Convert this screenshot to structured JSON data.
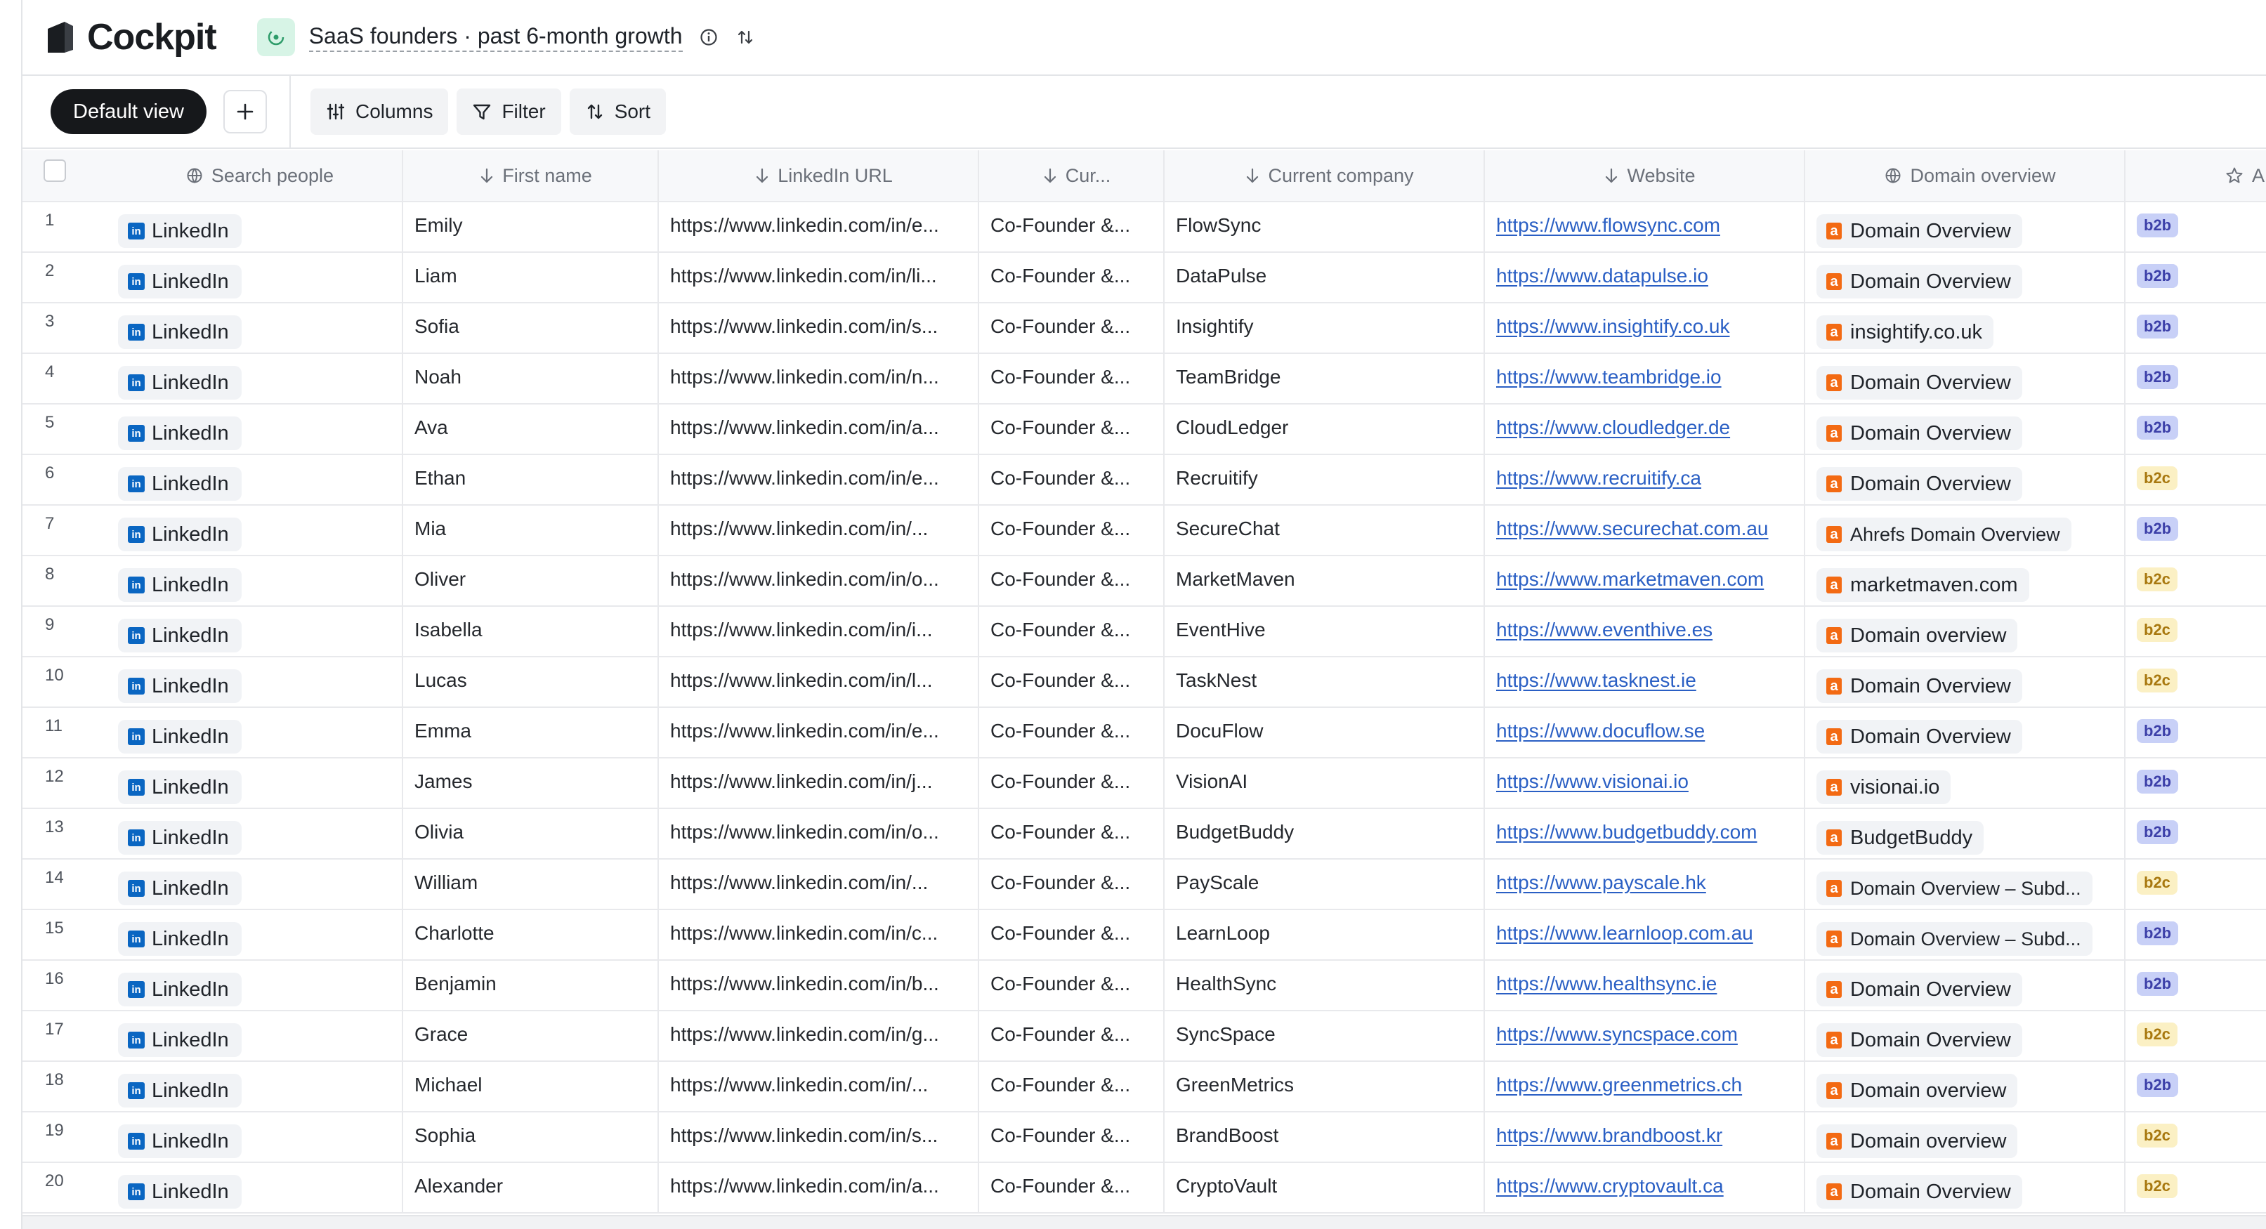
{
  "app": {
    "name": "Cockpit",
    "table_title": "SaaS founders · past 6-month growth"
  },
  "toolbar": {
    "view_label": "Default view",
    "columns_label": "Columns",
    "filter_label": "Filter",
    "sort_label": "Sort"
  },
  "columns": {
    "search": "Search people",
    "first_name": "First name",
    "linkedin_url": "LinkedIn URL",
    "current_title": "Cur...",
    "current_company": "Current company",
    "website": "Website",
    "domain_overview": "Domain overview",
    "next": "A"
  },
  "colors": {
    "b2b": "#c8d0f7",
    "b2c": "#fbf0c4",
    "link": "#2a5fc4",
    "linkedin": "#0a66c2",
    "ahrefs": "#f36a13"
  },
  "rows": [
    {
      "num": "1",
      "chip": "LinkedIn",
      "first": "Emily",
      "url": "https://www.linkedin.com/in/e...",
      "title": "Co-Founder &...",
      "company": "FlowSync",
      "website": "https://www.flowsync.com",
      "domain": "Domain Overview",
      "seg": "b2b"
    },
    {
      "num": "2",
      "chip": "LinkedIn",
      "first": "Liam",
      "url": "https://www.linkedin.com/in/li...",
      "title": "Co-Founder &...",
      "company": "DataPulse",
      "website": "https://www.datapulse.io",
      "domain": "Domain Overview",
      "seg": "b2b"
    },
    {
      "num": "3",
      "chip": "LinkedIn",
      "first": "Sofia",
      "url": "https://www.linkedin.com/in/s...",
      "title": "Co-Founder &...",
      "company": "Insightify",
      "website": "https://www.insightify.co.uk",
      "domain": "insightify.co.uk",
      "seg": "b2b"
    },
    {
      "num": "4",
      "chip": "LinkedIn",
      "first": "Noah",
      "url": "https://www.linkedin.com/in/n...",
      "title": "Co-Founder &...",
      "company": "TeamBridge",
      "website": "https://www.teambridge.io",
      "domain": "Domain Overview",
      "seg": "b2b"
    },
    {
      "num": "5",
      "chip": "LinkedIn",
      "first": "Ava",
      "url": "https://www.linkedin.com/in/a...",
      "title": "Co-Founder &...",
      "company": "CloudLedger",
      "website": "https://www.cloudledger.de",
      "domain": "Domain Overview",
      "seg": "b2b"
    },
    {
      "num": "6",
      "chip": "LinkedIn",
      "first": "Ethan",
      "url": "https://www.linkedin.com/in/e...",
      "title": "Co-Founder &...",
      "company": "Recruitify",
      "website": "https://www.recruitify.ca",
      "domain": "Domain Overview",
      "seg": "b2c"
    },
    {
      "num": "7",
      "chip": "LinkedIn",
      "first": "Mia",
      "url": "https://www.linkedin.com/in/...",
      "title": "Co-Founder &...",
      "company": "SecureChat",
      "website": "https://www.securechat.com.au",
      "domain": "Ahrefs Domain Overview",
      "seg": "b2b"
    },
    {
      "num": "8",
      "chip": "LinkedIn",
      "first": "Oliver",
      "url": "https://www.linkedin.com/in/o...",
      "title": "Co-Founder &...",
      "company": "MarketMaven",
      "website": "https://www.marketmaven.com",
      "domain": "marketmaven.com",
      "seg": "b2c"
    },
    {
      "num": "9",
      "chip": "LinkedIn",
      "first": "Isabella",
      "url": "https://www.linkedin.com/in/i...",
      "title": "Co-Founder &...",
      "company": "EventHive",
      "website": "https://www.eventhive.es",
      "domain": "Domain overview",
      "seg": "b2c"
    },
    {
      "num": "10",
      "chip": "LinkedIn",
      "first": "Lucas",
      "url": "https://www.linkedin.com/in/l...",
      "title": "Co-Founder &...",
      "company": "TaskNest",
      "website": "https://www.tasknest.ie",
      "domain": "Domain Overview",
      "seg": "b2c"
    },
    {
      "num": "11",
      "chip": "LinkedIn",
      "first": "Emma",
      "url": "https://www.linkedin.com/in/e...",
      "title": "Co-Founder &...",
      "company": "DocuFlow",
      "website": "https://www.docuflow.se",
      "domain": "Domain Overview",
      "seg": "b2b"
    },
    {
      "num": "12",
      "chip": "LinkedIn",
      "first": "James",
      "url": "https://www.linkedin.com/in/j...",
      "title": "Co-Founder &...",
      "company": "VisionAI",
      "website": "https://www.visionai.io",
      "domain": "visionai.io",
      "seg": "b2b"
    },
    {
      "num": "13",
      "chip": "LinkedIn",
      "first": "Olivia",
      "url": "https://www.linkedin.com/in/o...",
      "title": "Co-Founder &...",
      "company": "BudgetBuddy",
      "website": "https://www.budgetbuddy.com",
      "domain": "BudgetBuddy",
      "seg": "b2b"
    },
    {
      "num": "14",
      "chip": "LinkedIn",
      "first": "William",
      "url": "https://www.linkedin.com/in/...",
      "title": "Co-Founder &...",
      "company": "PayScale",
      "website": "https://www.payscale.hk",
      "domain": "Domain Overview – Subd...",
      "seg": "b2c"
    },
    {
      "num": "15",
      "chip": "LinkedIn",
      "first": "Charlotte",
      "url": "https://www.linkedin.com/in/c...",
      "title": "Co-Founder &...",
      "company": "LearnLoop",
      "website": "https://www.learnloop.com.au",
      "domain": "Domain Overview – Subd...",
      "seg": "b2b"
    },
    {
      "num": "16",
      "chip": "LinkedIn",
      "first": "Benjamin",
      "url": "https://www.linkedin.com/in/b...",
      "title": "Co-Founder &...",
      "company": "HealthSync",
      "website": "https://www.healthsync.ie",
      "domain": "Domain Overview",
      "seg": "b2b"
    },
    {
      "num": "17",
      "chip": "LinkedIn",
      "first": "Grace",
      "url": "https://www.linkedin.com/in/g...",
      "title": "Co-Founder &...",
      "company": "SyncSpace",
      "website": "https://www.syncspace.com",
      "domain": "Domain Overview",
      "seg": "b2c"
    },
    {
      "num": "18",
      "chip": "LinkedIn",
      "first": "Michael",
      "url": "https://www.linkedin.com/in/...",
      "title": "Co-Founder &...",
      "company": "GreenMetrics",
      "website": "https://www.greenmetrics.ch",
      "domain": "Domain overview",
      "seg": "b2b"
    },
    {
      "num": "19",
      "chip": "LinkedIn",
      "first": "Sophia",
      "url": "https://www.linkedin.com/in/s...",
      "title": "Co-Founder &...",
      "company": "BrandBoost",
      "website": "https://www.brandboost.kr",
      "domain": "Domain overview",
      "seg": "b2c"
    },
    {
      "num": "20",
      "chip": "LinkedIn",
      "first": "Alexander",
      "url": "https://www.linkedin.com/in/a...",
      "title": "Co-Founder &...",
      "company": "CryptoVault",
      "website": "https://www.cryptovault.ca",
      "domain": "Domain Overview",
      "seg": "b2c"
    }
  ]
}
